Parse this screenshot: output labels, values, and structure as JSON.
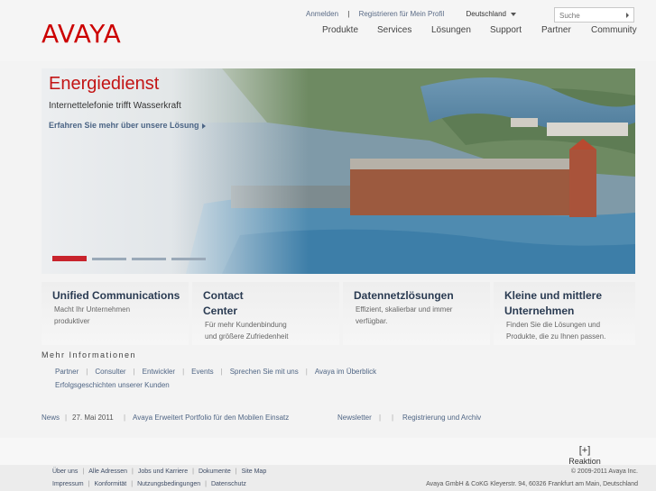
{
  "brand": {
    "logo_text": "AVAYA",
    "color": "#cc0000"
  },
  "util_links": [
    "Anmelden",
    "Registrieren für Mein Profil"
  ],
  "country": "Deutschland",
  "search": {
    "placeholder": "Suche"
  },
  "nav": [
    "Produkte",
    "Services",
    "Lösungen",
    "Support",
    "Partner",
    "Community"
  ],
  "hero": {
    "title": "Energiedienst",
    "subtitle": "Internettelefonie trifft Wasserkraft",
    "link": "Erfahren Sie mehr über unsere Lösung",
    "slides": 4,
    "active_slide": 1
  },
  "tiles": [
    {
      "title": "Unified Communications",
      "body": [
        "Macht Ihr Unternehmen",
        "produktiver"
      ]
    },
    {
      "title_lines": [
        "Contact",
        "Center"
      ],
      "body": [
        "Für mehr Kundenbindung",
        "und größere Zufriedenheit"
      ]
    },
    {
      "title": "Datennetzlösungen",
      "body": [
        "Effizient, skalierbar und immer",
        "verfügbar."
      ]
    },
    {
      "title_lines": [
        "Kleine und mittlere",
        "Unternehmen"
      ],
      "body": [
        "Finden Sie die Lösungen und",
        "Produkte, die zu Ihnen passen."
      ]
    }
  ],
  "more": {
    "title": "Mehr Informationen",
    "links": [
      "Partner",
      "Consulter",
      "Entwickler",
      "Events",
      "Sprechen Sie mit uns",
      "Avaya im Überblick"
    ],
    "links2": [
      "Erfolgsgeschichten unserer Kunden"
    ]
  },
  "news": {
    "label": "News",
    "date": "27. Mai 2011",
    "headline": "Avaya Erweitert Portfolio für den Mobilen Einsatz",
    "newsletter": "Newsletter",
    "register": "Registrierung und Archiv"
  },
  "feedback": {
    "icon": "[+]",
    "label": "Reaktion"
  },
  "footer": {
    "row1": [
      "Über uns",
      "Alle Adressen",
      "Jobs und Karriere",
      "Dokumente",
      "Site Map"
    ],
    "row2": [
      "Impressum",
      "Konformität",
      "Nutzungsbedingungen",
      "Datenschutz"
    ],
    "copyright": "© 2009-2011 Avaya Inc.",
    "address": "Avaya GmbH & CoKG Kleyerstr. 94, 60326 Frankfurt am Main, Deutschland"
  }
}
